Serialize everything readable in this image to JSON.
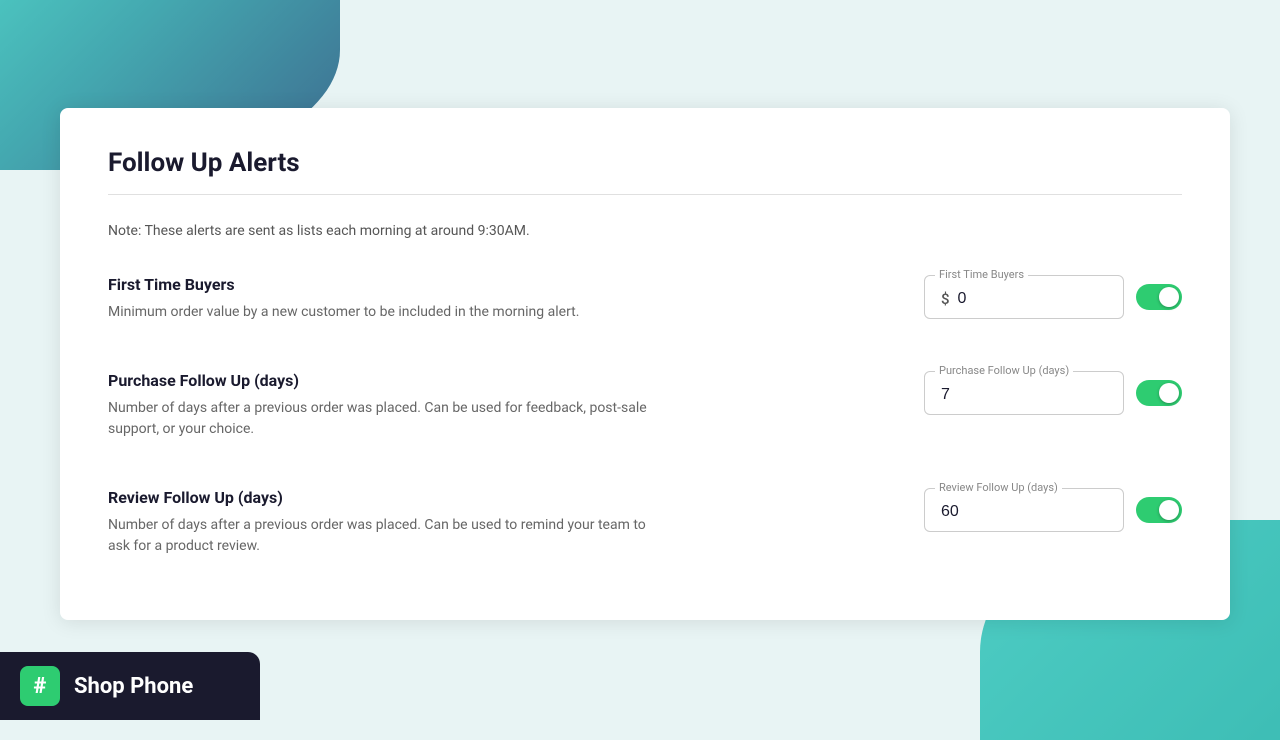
{
  "page": {
    "title": "Follow Up Alerts",
    "note": "Note: These alerts are sent as lists each morning at around 9:30AM."
  },
  "alerts": [
    {
      "id": "first-time-buyers",
      "title": "First Time Buyers",
      "subtitle": "Minimum order value by a new customer to be included in the morning alert.",
      "input_label": "First Time Buyers",
      "input_prefix": "$",
      "input_value": "0",
      "toggle_on": true
    },
    {
      "id": "purchase-follow-up",
      "title": "Purchase Follow Up (days)",
      "subtitle": "Number of days after a previous order was placed. Can be used for feedback, post-sale support, or your choice.",
      "input_label": "Purchase Follow Up (days)",
      "input_prefix": "",
      "input_value": "7",
      "toggle_on": true
    },
    {
      "id": "review-follow-up",
      "title": "Review Follow Up (days)",
      "subtitle": "Number of days after a previous order was placed. Can be used to remind your team to ask for a product review.",
      "input_label": "Review Follow Up (days)",
      "input_prefix": "",
      "input_value": "60",
      "toggle_on": true
    }
  ],
  "branding": {
    "icon": "#",
    "name": "Shop Phone"
  }
}
